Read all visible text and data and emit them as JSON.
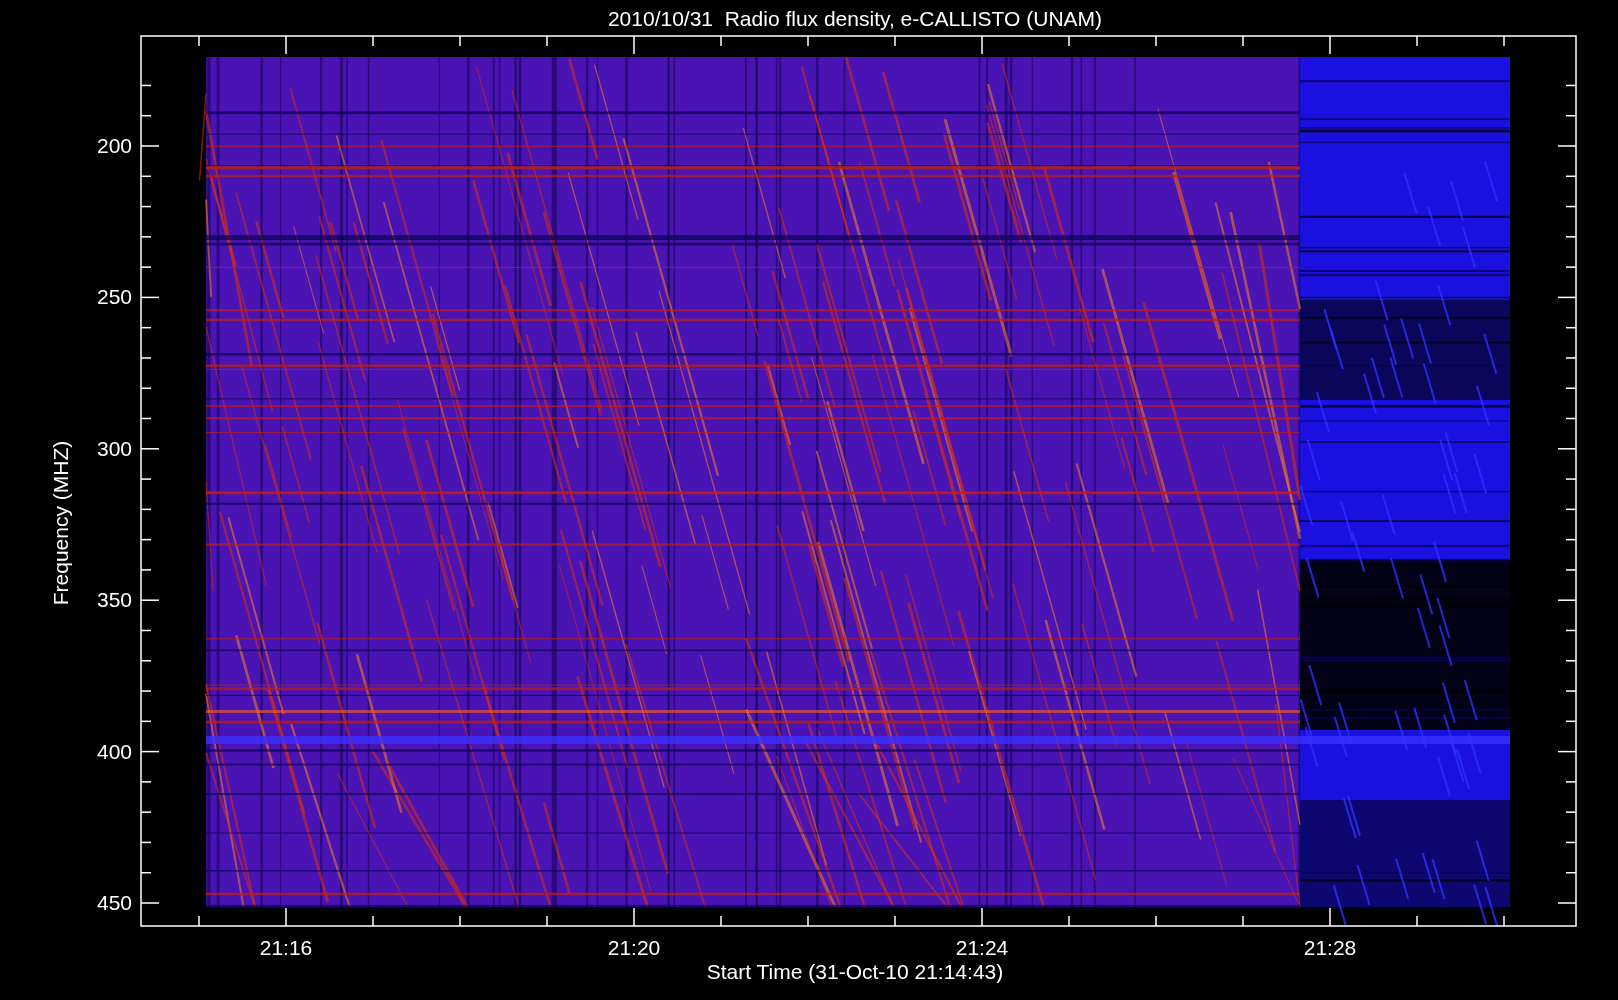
{
  "title": "2010/10/31  Radio flux density, e-CALLISTO (UNAM)",
  "ylabel": "Frequency (MHZ)",
  "xlabel": "Start Time (31-Oct-10 21:14:43)",
  "yticks": [
    "200",
    "250",
    "300",
    "350",
    "400",
    "450"
  ],
  "xticks": [
    "21:16",
    "21:20",
    "21:24",
    "21:28"
  ]
}
